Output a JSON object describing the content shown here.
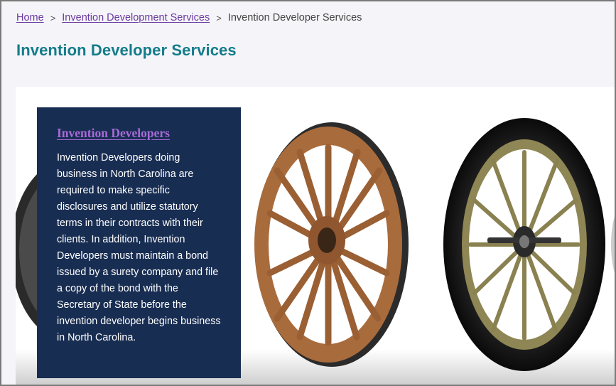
{
  "breadcrumb": {
    "items": [
      {
        "label": "Home",
        "link": true
      },
      {
        "label": "Invention Development Services",
        "link": true
      },
      {
        "label": "Invention Developer Services",
        "link": false
      }
    ],
    "separator": ">"
  },
  "page": {
    "title": "Invention Developer Services"
  },
  "hero": {
    "image_subject": "wheels-image",
    "card": {
      "title": "Invention Developers",
      "body": "Invention Developers doing business in North Carolina are required to make specific disclosures and utilize statutory terms in their contracts with their clients. In addition, Invention Developers must maintain a bond issued by a surety company and file a copy of the bond with the Secretary of State before the invention developer begins business in North Carolina."
    }
  },
  "colors": {
    "title": "#137c8a",
    "link": "#6b3aa0",
    "card_background": "#182d52",
    "card_title": "#a86ad6"
  }
}
